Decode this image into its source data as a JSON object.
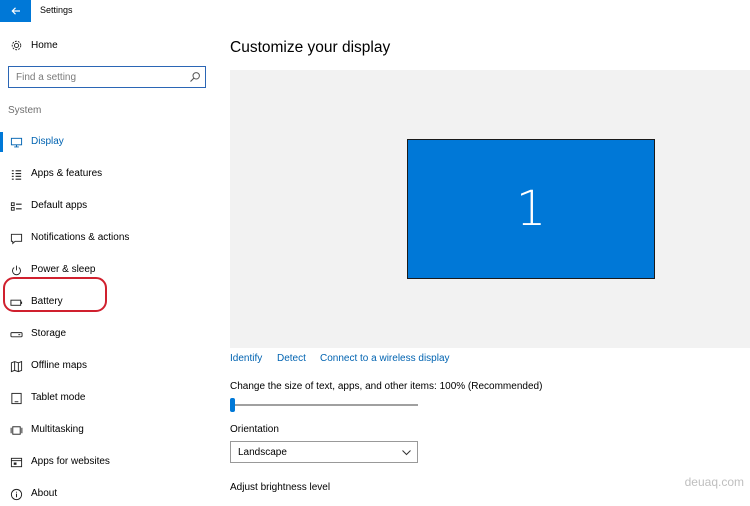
{
  "window": {
    "title": "Settings",
    "back_icon": "arrow-left-icon"
  },
  "accent_color": "#0078d7",
  "sidebar": {
    "home": {
      "label": "Home",
      "icon": "gear-icon"
    },
    "search": {
      "placeholder": "Find a setting",
      "value": "",
      "icon": "search-icon"
    },
    "section_header": "System",
    "items": [
      {
        "label": "Display",
        "icon": "display-icon",
        "active": true
      },
      {
        "label": "Apps & features",
        "icon": "apps-list-icon"
      },
      {
        "label": "Default apps",
        "icon": "default-apps-icon"
      },
      {
        "label": "Notifications & actions",
        "icon": "notification-icon"
      },
      {
        "label": "Power & sleep",
        "icon": "power-icon",
        "highlighted": true
      },
      {
        "label": "Battery",
        "icon": "battery-icon"
      },
      {
        "label": "Storage",
        "icon": "storage-icon"
      },
      {
        "label": "Offline maps",
        "icon": "map-icon"
      },
      {
        "label": "Tablet mode",
        "icon": "tablet-icon"
      },
      {
        "label": "Multitasking",
        "icon": "multitasking-icon"
      },
      {
        "label": "Apps for websites",
        "icon": "apps-websites-icon"
      },
      {
        "label": "About",
        "icon": "info-icon"
      }
    ]
  },
  "main": {
    "title": "Customize your display",
    "monitor_number": "1",
    "links": [
      "Identify",
      "Detect",
      "Connect to a wireless display"
    ],
    "text_size": {
      "label": "Change the size of text, apps, and other items: 100% (Recommended)",
      "value_percent": 100
    },
    "orientation": {
      "label": "Orientation",
      "value": "Landscape"
    },
    "brightness": {
      "label": "Adjust brightness level"
    }
  },
  "watermark": "deuaq.com"
}
